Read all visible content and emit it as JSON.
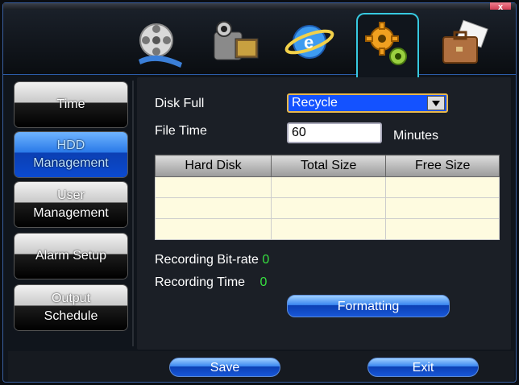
{
  "window": {
    "close_label": "x"
  },
  "toolbar": {
    "icons": [
      {
        "name": "record-icon"
      },
      {
        "name": "camera-icon"
      },
      {
        "name": "network-icon"
      },
      {
        "name": "settings-gears-icon"
      },
      {
        "name": "briefcase-icon"
      }
    ]
  },
  "sidebar": {
    "items": [
      {
        "lines": [
          "Time"
        ]
      },
      {
        "lines": [
          "HDD",
          "Management"
        ]
      },
      {
        "lines": [
          "User",
          "Management"
        ]
      },
      {
        "lines": [
          "Alarm Setup"
        ]
      },
      {
        "lines": [
          "Output",
          "Schedule"
        ]
      }
    ]
  },
  "form": {
    "disk_full_label": "Disk Full",
    "disk_full_value": "Recycle",
    "file_time_label": "File Time",
    "file_time_value": "60",
    "file_time_unit": "Minutes"
  },
  "table": {
    "columns": [
      "Hard Disk",
      "Total Size",
      "Free Size"
    ],
    "rows": [
      [
        "",
        "",
        ""
      ],
      [
        "",
        "",
        ""
      ],
      [
        "",
        "",
        ""
      ]
    ]
  },
  "stats": {
    "bitrate_label": "Recording Bit-rate",
    "bitrate_value": "0",
    "time_label": "Recording Time",
    "time_value": "0"
  },
  "buttons": {
    "formatting": "Formatting",
    "save": "Save",
    "exit": "Exit"
  },
  "colors": {
    "accent": "#37c9e0",
    "select_bg": "#1452ff",
    "value_green": "#37e040"
  }
}
